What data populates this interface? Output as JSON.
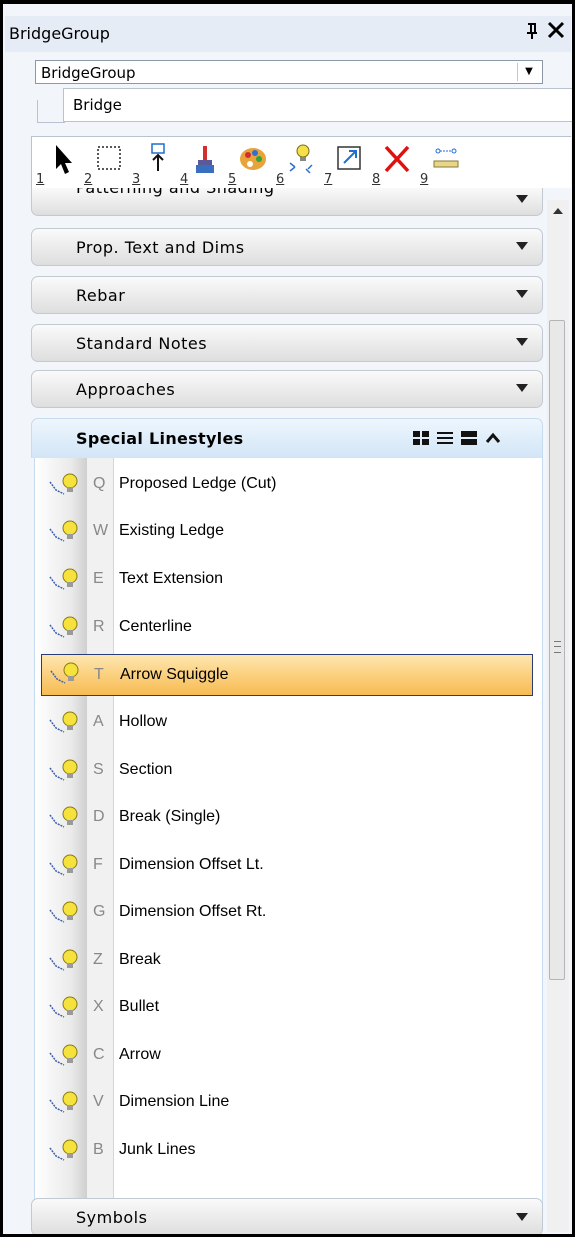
{
  "window": {
    "title": "BridgeGroup",
    "pin_glyph": "ᵖ",
    "close_glyph": "✕"
  },
  "group_select": {
    "value": "BridgeGroup",
    "arrow": "▼"
  },
  "sub_tab": {
    "label": "Bridge"
  },
  "toolbar": {
    "tools": [
      {
        "num": "1",
        "icon": "arrow-pointer-icon"
      },
      {
        "num": "2",
        "icon": "dashed-select-icon"
      },
      {
        "num": "3",
        "icon": "move-icon"
      },
      {
        "num": "4",
        "icon": "brush-icon"
      },
      {
        "num": "5",
        "icon": "palette-icon"
      },
      {
        "num": "6",
        "icon": "lightbulb-sparkle-icon"
      },
      {
        "num": "7",
        "icon": "scale-box-icon"
      },
      {
        "num": "8",
        "icon": "delete-x-icon"
      },
      {
        "num": "9",
        "icon": "measure-icon"
      }
    ]
  },
  "sections_above": [
    {
      "label": "Patterning and Shading"
    },
    {
      "label": "Prop. Text and Dims"
    },
    {
      "label": "Rebar"
    },
    {
      "label": "Standard Notes"
    },
    {
      "label": "Approaches"
    }
  ],
  "active_section": {
    "label": "Special Linestyles",
    "items": [
      {
        "key": "Q",
        "name": "Proposed Ledge (Cut)"
      },
      {
        "key": "W",
        "name": "Existing Ledge"
      },
      {
        "key": "E",
        "name": "Text Extension"
      },
      {
        "key": "R",
        "name": "Centerline"
      },
      {
        "key": "T",
        "name": "Arrow Squiggle"
      },
      {
        "key": "A",
        "name": "Hollow"
      },
      {
        "key": "S",
        "name": "Section"
      },
      {
        "key": "D",
        "name": "Break (Single)"
      },
      {
        "key": "F",
        "name": "Dimension Offset Lt."
      },
      {
        "key": "G",
        "name": "Dimension Offset Rt."
      },
      {
        "key": "Z",
        "name": "Break"
      },
      {
        "key": "X",
        "name": "Bullet"
      },
      {
        "key": "C",
        "name": "Arrow"
      },
      {
        "key": "V",
        "name": "Dimension Line"
      },
      {
        "key": "B",
        "name": "Junk Lines"
      }
    ],
    "selected_key": "T"
  },
  "sections_below": [
    {
      "label": "Symbols"
    }
  ]
}
